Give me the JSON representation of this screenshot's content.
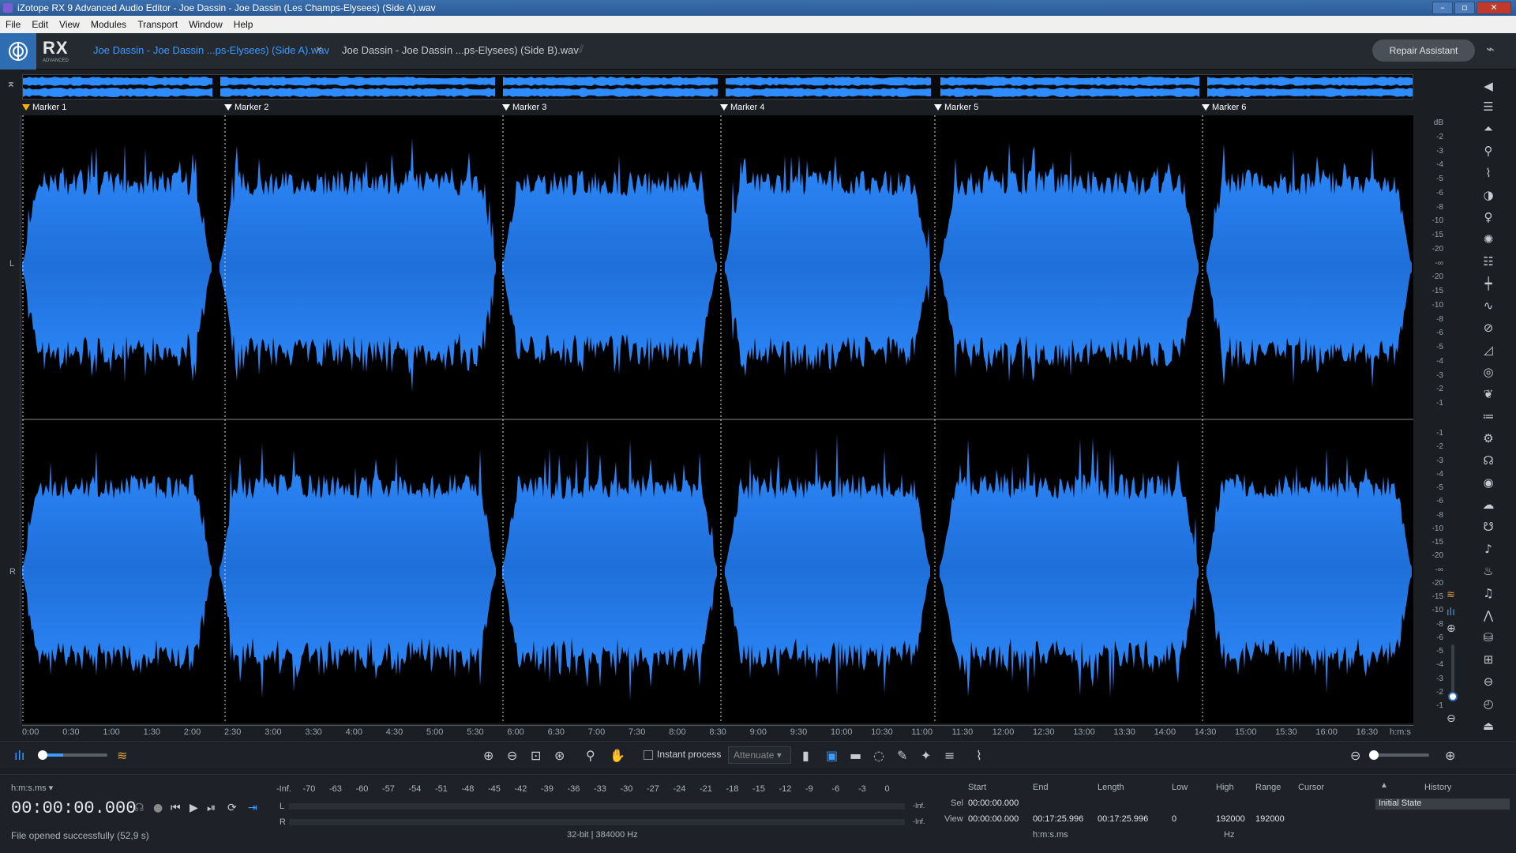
{
  "title": "iZotope RX 9 Advanced Audio Editor - Joe Dassin - Joe Dassin (Les Champs-Elysees) (Side A).wav",
  "menu": [
    "File",
    "Edit",
    "View",
    "Modules",
    "Transport",
    "Window",
    "Help"
  ],
  "logo": {
    "text": "RX",
    "sub": "ADVANCED"
  },
  "tabs": [
    {
      "label": "Joe Dassin - Joe Dassin ...ps-Elysees) (Side A).wav",
      "active": true
    },
    {
      "label": "Joe Dassin - Joe Dassin ...ps-Elysees) (Side B).wav",
      "active": false
    }
  ],
  "repair_assistant": "Repair Assistant",
  "markers": [
    "Marker 1",
    "Marker 2",
    "Marker 3",
    "Marker 4",
    "Marker 5",
    "Marker 6"
  ],
  "channels": {
    "left": "L",
    "right": "R"
  },
  "db_scale": [
    "dB",
    "-2",
    "-3",
    "-4",
    "-5",
    "-6",
    "-8",
    "-10",
    "-15",
    "-20",
    "-∞",
    "-20",
    "-15",
    "-10",
    "-8",
    "-6",
    "-5",
    "-4",
    "-3",
    "-2",
    "-1"
  ],
  "db_scale_r": [
    "-1",
    "-2",
    "-3",
    "-4",
    "-5",
    "-6",
    "-8",
    "-10",
    "-15",
    "-20",
    "-∞",
    "-20",
    "-15",
    "-10",
    "-8",
    "-6",
    "-5",
    "-4",
    "-3",
    "-2",
    "-1"
  ],
  "timeline": [
    "0:00",
    "0:30",
    "1:00",
    "1:30",
    "2:00",
    "2:30",
    "3:00",
    "3:30",
    "4:00",
    "4:30",
    "5:00",
    "5:30",
    "6:00",
    "6:30",
    "7:00",
    "7:30",
    "8:00",
    "8:30",
    "9:00",
    "9:30",
    "10:00",
    "10:30",
    "11:00",
    "11:30",
    "12:00",
    "12:30",
    "13:00",
    "13:30",
    "14:00",
    "14:30",
    "15:00",
    "15:30",
    "16:00",
    "16:30",
    "h:m:s"
  ],
  "toolbar": {
    "instant_process": "Instant process",
    "attenuate": "Attenuate"
  },
  "transport": {
    "format": "h:m:s.ms",
    "timecode": "00:00:00.000",
    "status": "File opened successfully (52,9 s)"
  },
  "meter": {
    "scale": [
      "-Inf.",
      "-70",
      "-63",
      "-60",
      "-57",
      "-54",
      "-51",
      "-48",
      "-45",
      "-42",
      "-39",
      "-36",
      "-33",
      "-30",
      "-27",
      "-24",
      "-21",
      "-18",
      "-15",
      "-12",
      "-9",
      "-6",
      "-3",
      "0"
    ],
    "l": "L",
    "r": "R",
    "l_peak": "-Inf.",
    "r_peak": "-Inf.",
    "info": "32-bit | 384000 Hz"
  },
  "selection": {
    "headers": [
      "Start",
      "End",
      "Length"
    ],
    "sel_label": "Sel",
    "view_label": "View",
    "sel_start": "00:00:00.000",
    "view_start": "00:00:00.000",
    "view_end": "00:17:25.996",
    "view_length": "00:17:25.996",
    "units": "h:m:s.ms"
  },
  "frequency": {
    "headers": [
      "Low",
      "High",
      "Range"
    ],
    "low": "0",
    "high": "192000",
    "range": "192000",
    "units": "Hz"
  },
  "cursor": "Cursor",
  "history": {
    "title": "History",
    "items": [
      "Initial State"
    ]
  }
}
